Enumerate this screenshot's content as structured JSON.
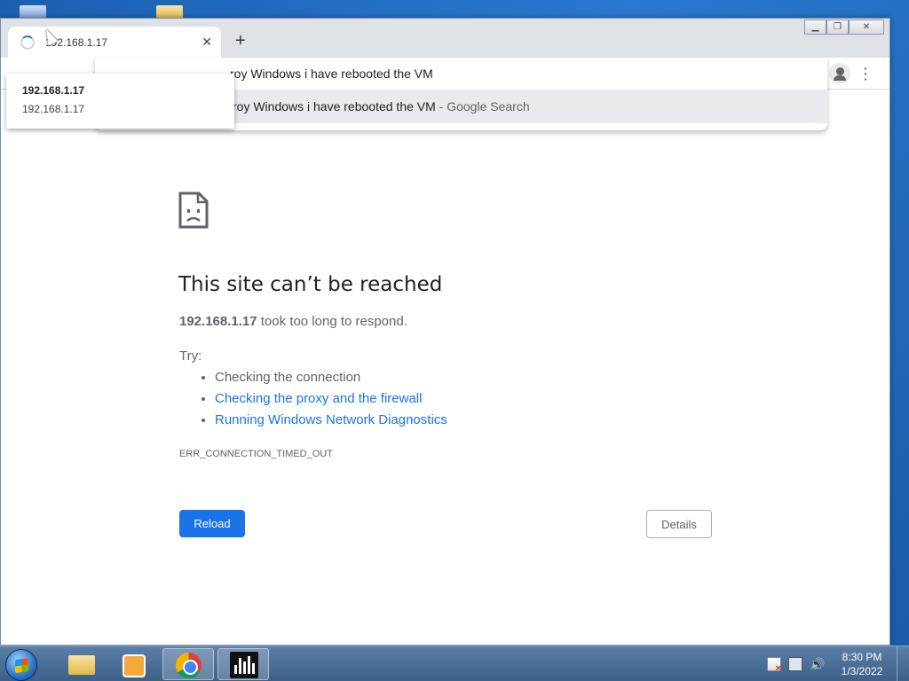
{
  "browser": {
    "tab": {
      "title": "192.168.1.17",
      "close": "✕"
    },
    "new_tab": "+",
    "window_controls": {
      "minimize": "▁",
      "restore": "❐",
      "close": "✕"
    },
    "menu_icon": "⋮",
    "omnibox": {
      "input": "roy Windows i have rebooted the VM",
      "suggestion": "roy Windows i have rebooted the VM",
      "suggestion_suffix": " - Google Search"
    },
    "hovercard": {
      "title": "192.168.1.17",
      "subtitle": "192.168.1.17"
    }
  },
  "error_page": {
    "heading": "This site can’t be reached",
    "host": "192.168.1.17",
    "message": " took too long to respond.",
    "try_label": "Try:",
    "suggestions": [
      "Checking the connection",
      "Checking the proxy and the firewall",
      "Running Windows Network Diagnostics"
    ],
    "error_code": "ERR_CONNECTION_TIMED_OUT",
    "reload": "Reload",
    "details": "Details"
  },
  "taskbar": {
    "clock_time": "8:30 PM",
    "clock_date": "1/3/2022",
    "volume": "🔊"
  }
}
